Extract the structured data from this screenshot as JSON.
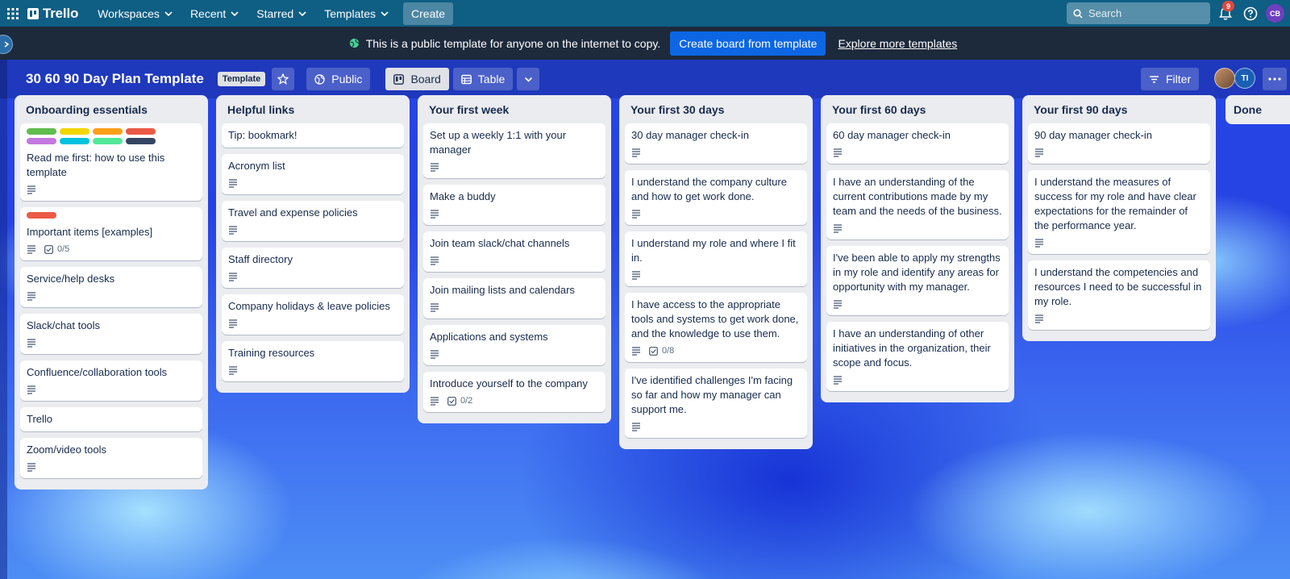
{
  "nav": {
    "logo": "Trello",
    "workspaces": "Workspaces",
    "recent": "Recent",
    "starred": "Starred",
    "templates": "Templates",
    "create": "Create",
    "search_placeholder": "Search",
    "notifications_count": "9",
    "user_initials": "CB"
  },
  "banner": {
    "text": "This is a public template for anyone on the internet to copy.",
    "create_button": "Create board from template",
    "explore_link": "Explore more templates"
  },
  "board": {
    "title": "30 60 90 Day Plan Template",
    "badge": "Template",
    "visibility": "Public",
    "view_board": "Board",
    "view_table": "Table",
    "filter": "Filter",
    "member_initials": "TI"
  },
  "colors": {
    "label_green": "#61bd4f",
    "label_yellow": "#f2d600",
    "label_orange": "#ff9f1a",
    "label_red": "#eb5a46",
    "label_purple": "#c377e0",
    "label_sky": "#00c2e0",
    "label_lime": "#51e898",
    "label_black": "#344563"
  },
  "lists": [
    {
      "title": "Onboarding essentials",
      "cards": [
        {
          "title": "Read me first: how to use this template",
          "desc": true
        },
        {
          "title": "Important items [examples]",
          "desc": true,
          "checklist": "0/5"
        },
        {
          "title": "Service/help desks",
          "desc": true
        },
        {
          "title": "Slack/chat tools",
          "desc": true
        },
        {
          "title": "Confluence/collaboration tools",
          "desc": true
        },
        {
          "title": "Trello",
          "desc": false
        },
        {
          "title": "Zoom/video tools",
          "desc": true
        }
      ]
    },
    {
      "title": "Helpful links",
      "cards": [
        {
          "title": "Tip: bookmark!",
          "desc": false
        },
        {
          "title": "Acronym list",
          "desc": true
        },
        {
          "title": "Travel and expense policies",
          "desc": true
        },
        {
          "title": "Staff directory",
          "desc": true
        },
        {
          "title": "Company holidays & leave policies",
          "desc": true
        },
        {
          "title": "Training resources",
          "desc": true
        }
      ]
    },
    {
      "title": "Your first week",
      "cards": [
        {
          "title": "Set up a weekly 1:1 with your manager",
          "desc": true
        },
        {
          "title": "Make a buddy",
          "desc": true
        },
        {
          "title": "Join team slack/chat channels",
          "desc": true
        },
        {
          "title": "Join mailing lists and calendars",
          "desc": true
        },
        {
          "title": "Applications and systems",
          "desc": true
        },
        {
          "title": "Introduce yourself to the company",
          "desc": true,
          "checklist": "0/2"
        }
      ]
    },
    {
      "title": "Your first 30 days",
      "cards": [
        {
          "title": "30 day manager check-in",
          "desc": true
        },
        {
          "title": "I understand the company culture and how to get work done.",
          "desc": true
        },
        {
          "title": "I understand my role and where I fit in.",
          "desc": true
        },
        {
          "title": "I have access to the appropriate tools and systems to get work done, and the knowledge to use them.",
          "desc": true,
          "checklist": "0/8"
        },
        {
          "title": "I've identified challenges I'm facing so far and how my manager can support me.",
          "desc": true
        }
      ]
    },
    {
      "title": "Your first 60 days",
      "cards": [
        {
          "title": "60 day manager check-in",
          "desc": true
        },
        {
          "title": "I have an understanding of the current contributions made by my team and the needs of the business.",
          "desc": true
        },
        {
          "title": "I've been able to apply my strengths in my role and identify any areas for opportunity with my manager.",
          "desc": true
        },
        {
          "title": "I have an understanding of other initiatives in the organization, their scope and focus.",
          "desc": true
        }
      ]
    },
    {
      "title": "Your first 90 days",
      "cards": [
        {
          "title": "90 day manager check-in",
          "desc": true
        },
        {
          "title": "I understand the measures of success for my role and have clear expectations for the remainder of the performance year.",
          "desc": true
        },
        {
          "title": "I understand the competencies and resources I need to be successful in my role.",
          "desc": true
        }
      ]
    },
    {
      "title": "Done",
      "cards": []
    }
  ]
}
